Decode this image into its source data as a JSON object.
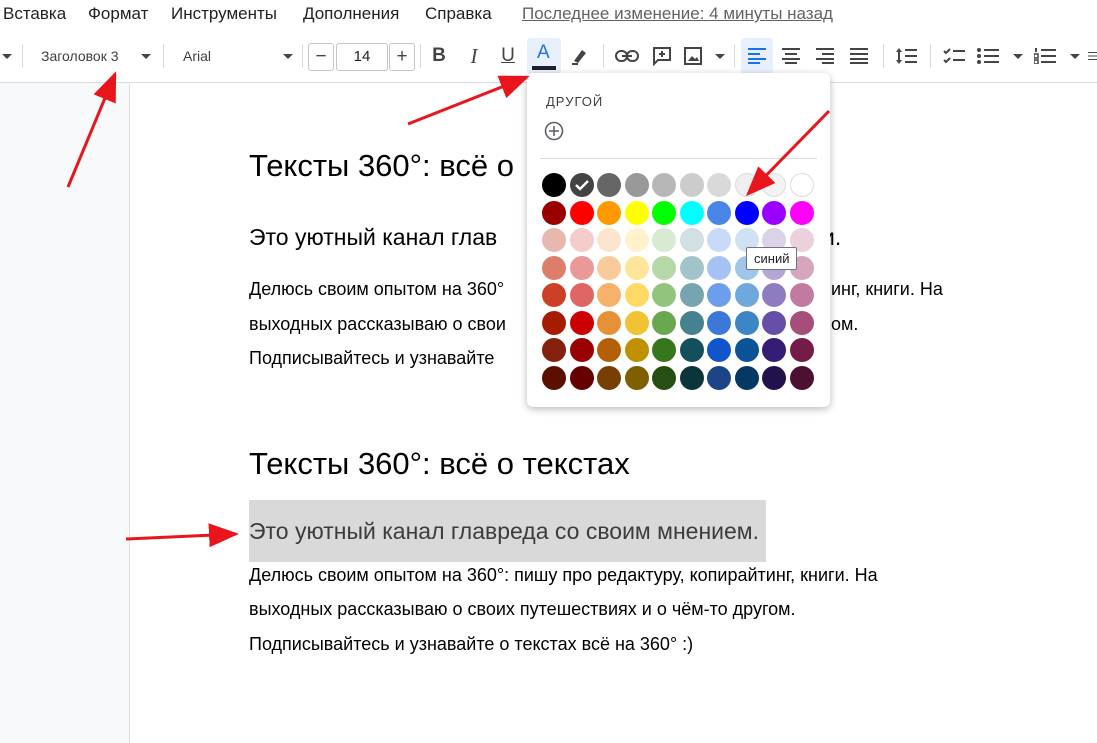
{
  "menu": {
    "items": [
      "Вставка",
      "Формат",
      "Инструменты",
      "Дополнения",
      "Справка"
    ],
    "last_edit": "Последнее изменение: 4 минуты назад"
  },
  "toolbar": {
    "style": "Заголовок 3",
    "font": "Arial",
    "font_size": "14",
    "minus": "−",
    "plus": "+",
    "bold": "B",
    "italic": "I",
    "underline": "U",
    "text_color": "A",
    "text_color_bar": "#202124",
    "active_accent": "#1a73e8"
  },
  "palette": {
    "custom_label": "ДРУГОЙ",
    "tooltip": "синий",
    "selected_row": 0,
    "selected_col": 1,
    "rows": [
      [
        "#000000",
        "#434343",
        "#666666",
        "#999999",
        "#b7b7b7",
        "#cccccc",
        "#d9d9d9",
        "#efefef",
        "#f3f3f3",
        "#ffffff"
      ],
      [
        "#980000",
        "#ff0000",
        "#ff9900",
        "#ffff00",
        "#00ff00",
        "#00ffff",
        "#4a86e8",
        "#0000ff",
        "#9900ff",
        "#ff00ff"
      ],
      [
        "#e6b8af",
        "#f4cccc",
        "#fce5cd",
        "#fff2cc",
        "#d9ead3",
        "#d0e0e3",
        "#c9daf8",
        "#cfe2f3",
        "#d9d2e9",
        "#ead1dc"
      ],
      [
        "#dd7e6b",
        "#ea9999",
        "#f9cb9c",
        "#ffe599",
        "#b6d7a8",
        "#a2c4c9",
        "#a4c2f4",
        "#9fc5e8",
        "#b4a7d6",
        "#d5a6bd"
      ],
      [
        "#cc4125",
        "#e06666",
        "#f6b26b",
        "#ffd966",
        "#93c47d",
        "#76a5af",
        "#6d9eeb",
        "#6fa8dc",
        "#8e7cc3",
        "#c27ba0"
      ],
      [
        "#a61c00",
        "#cc0000",
        "#e69138",
        "#f1c232",
        "#6aa84f",
        "#45818e",
        "#3c78d8",
        "#3d85c6",
        "#674ea7",
        "#a64d79"
      ],
      [
        "#85200c",
        "#990000",
        "#b45f06",
        "#bf9000",
        "#38761d",
        "#134f5c",
        "#1155cc",
        "#0b5394",
        "#351c75",
        "#741b47"
      ],
      [
        "#5b0f00",
        "#660000",
        "#783f04",
        "#7f6000",
        "#274e13",
        "#0c343d",
        "#1c4587",
        "#073763",
        "#20124d",
        "#4c1130"
      ]
    ]
  },
  "document": {
    "block1": {
      "title": "Тексты 360°: всё о",
      "subtitle": "Это уютный канал глав",
      "subtitle_tail": "и.",
      "line1": "Делюсь своим опытом на 360°",
      "line1_tail": "инг, книги. На",
      "line2": "выходных рассказываю о свои",
      "line2_tail": "ом.",
      "line3": "Подписывайтесь и узнавайте"
    },
    "block2": {
      "title": "Тексты 360°: всё о текстах",
      "subtitle": "Это уютный канал главреда со своим мнением.",
      "line1": "Делюсь своим опытом на 360°: пишу про редактуру, копирайтинг, книги. На",
      "line2": "выходных рассказываю о своих путешествиях и о чём-то другом.",
      "line3": "Подписывайтесь и узнавайте о текстах всё на 360° :)"
    }
  },
  "annotation_color": "#e8161c"
}
